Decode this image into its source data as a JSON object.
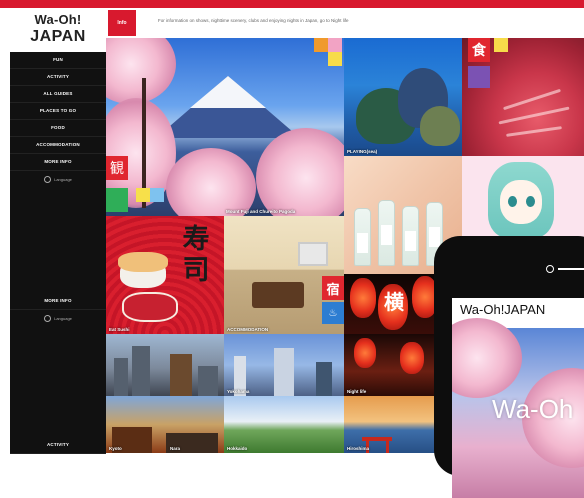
{
  "brand": {
    "line1": "Wa-Oh!",
    "line2": "JAPAN",
    "accent": "#d8192e"
  },
  "header": {
    "info_tab": "Info",
    "info_text": "For information on shows, nighttime scenery, clubs and enjoying nights in Japan, go to Night life"
  },
  "sidebar": {
    "items": [
      "FUN",
      "ACTIVITY",
      "ALL GUIDES",
      "PLACES TO GO",
      "FOOD",
      "ACCOMMODATION",
      "MORE INFO"
    ],
    "language": "Language",
    "group2": {
      "more_info": "MORE INFO",
      "language": "Language"
    },
    "bottom_item": "ACTIVITY"
  },
  "tiles": {
    "fuji": "Mount Fuji and Chureito Pagoda",
    "coral": "PLAYING(sea)",
    "sushi": "Eat Sushi",
    "room": "ACCOMMODATION",
    "night": "Night life",
    "yokohama": "Yokohama",
    "kyoto": "Kyoto",
    "nara": "Nara",
    "hokkaido": "Hokkaido",
    "hiroshima": "Hiroshima"
  },
  "glyphs": {
    "kanji_sushi": "寿司",
    "kanji_food": "食",
    "kanji_sight": "観",
    "kanji_inn": "宿",
    "kanji_night": "横"
  },
  "phone": {
    "logo": "Wa-Oh!JAPAN",
    "hero_text": "Wa-Oh"
  }
}
